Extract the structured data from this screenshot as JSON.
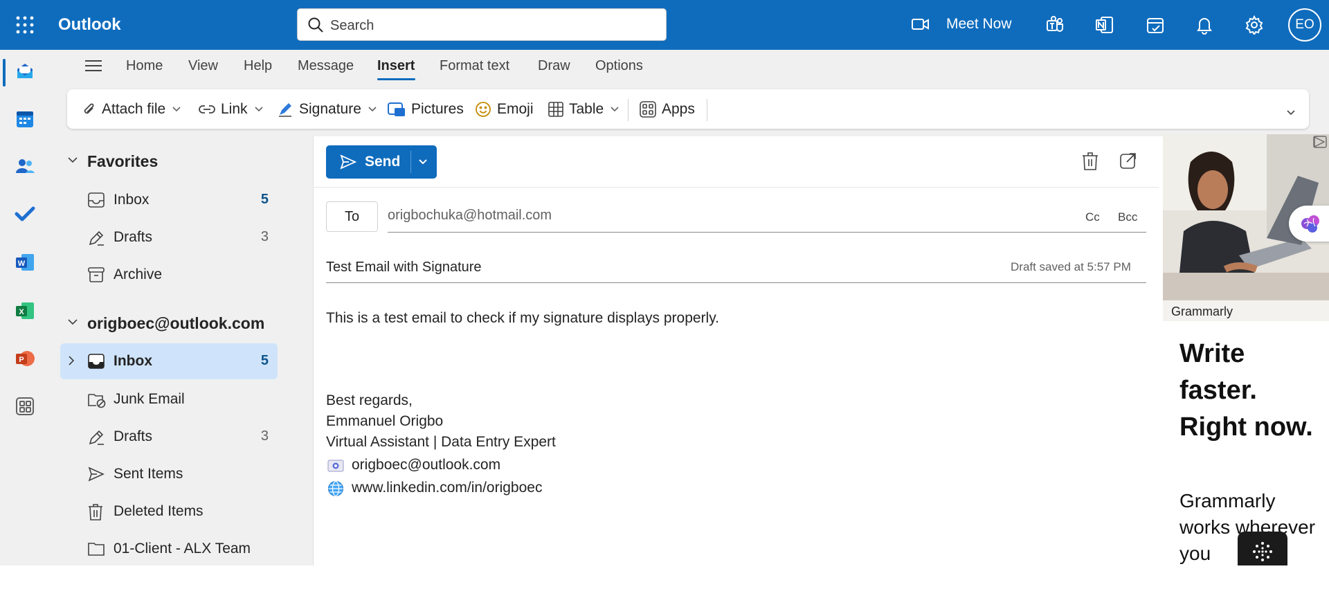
{
  "header": {
    "app_title": "Outlook",
    "search_placeholder": "Search",
    "meet_now": "Meet Now",
    "avatar_initials": "EO",
    "icons": [
      "waffle-icon",
      "video-icon",
      "teams-icon",
      "onenote-icon",
      "todo-icon",
      "bell-icon",
      "gear-icon"
    ]
  },
  "rail": {
    "icons": [
      "mail-icon",
      "calendar-icon",
      "people-icon",
      "todo-icon",
      "word-icon",
      "excel-icon",
      "powerpoint-icon",
      "apps-icon"
    ],
    "active": "mail-icon"
  },
  "tabs": [
    "Home",
    "View",
    "Help",
    "Message",
    "Insert",
    "Format text",
    "Draw",
    "Options"
  ],
  "active_tab": "Insert",
  "ribbon": {
    "attach_file": "Attach file",
    "link": "Link",
    "signature": "Signature",
    "pictures": "Pictures",
    "emoji": "Emoji",
    "table": "Table",
    "apps": "Apps"
  },
  "folders": {
    "favorites_header": "Favorites",
    "favorites": [
      {
        "label": "Inbox",
        "count": "5"
      },
      {
        "label": "Drafts",
        "count": "3"
      },
      {
        "label": "Archive",
        "count": ""
      }
    ],
    "account_header": "origboec@outlook.com",
    "account_folders": [
      {
        "label": "Inbox",
        "count": "5",
        "selected": true
      },
      {
        "label": "Junk Email",
        "count": ""
      },
      {
        "label": "Drafts",
        "count": "3"
      },
      {
        "label": "Sent Items",
        "count": ""
      },
      {
        "label": "Deleted Items",
        "count": ""
      },
      {
        "label": "01-Client - ALX Team",
        "count": ""
      }
    ]
  },
  "compose": {
    "send_label": "Send",
    "to_label": "To",
    "to_value": "origbochuka@hotmail.com",
    "cc_label": "Cc",
    "bcc_label": "Bcc",
    "subject": "Test Email with Signature",
    "draft_saved": "Draft saved at 5:57 PM",
    "body": "This is a test email to check if my signature displays properly.",
    "signature": {
      "closing": "Best regards,",
      "name": "Emmanuel Origbo",
      "title": "Virtual Assistant | Data Entry Expert",
      "email": "origboec@outlook.com",
      "linkedin": "www.linkedin.com/in/origboec"
    }
  },
  "ad": {
    "brand": "Grammarly",
    "headline": "Write faster. Right now.",
    "copy": "Grammarly works wherever you"
  },
  "colors": {
    "brand_blue": "#0f6cbd",
    "selected_folder": "#cfe4fa",
    "pane_bg": "#f0f0f0"
  }
}
